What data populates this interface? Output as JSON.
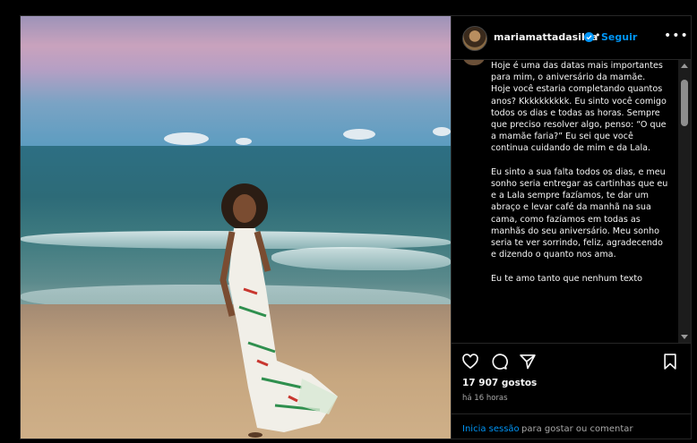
{
  "colors": {
    "background": "#000000",
    "text": "#f5f5f5",
    "secondary_text": "#a8a8a8",
    "link": "#0095f6",
    "border": "#262626"
  },
  "photo": {
    "description_icon": "beach-photo"
  },
  "header": {
    "username": "mariamattadasilva",
    "verified_icon": "verified-badge-icon",
    "separator": "•",
    "follow_label": "Seguir",
    "more_icon": "more-horizontal-icon",
    "more_label": "•••"
  },
  "caption": {
    "text": "Hoje é uma das datas mais importantes para mim, o aniversário da mamãe.\nHoje você estaria completando quantos anos? Kkkkkkkkkk. Eu sinto você comigo todos os dias e todas as horas. Sempre que preciso resolver algo, penso: “O que a mamãe faria?” Eu sei que você continua cuidando de mim e da Lala.\n\nEu sinto a sua falta todos os dias, e meu sonho seria entregar as cartinhas que eu e a Lala sempre fazíamos, te dar um abraço e levar café da manhã na sua cama, como fazíamos em todas as manhãs do seu aniversário. Meu sonho seria te ver sorrindo, feliz, agradecendo e dizendo o quanto nos ama.\n\nEu te amo tanto que nenhum texto"
  },
  "actions": {
    "like_icon": "heart-icon",
    "comment_icon": "comment-icon",
    "share_icon": "paper-plane-icon",
    "save_icon": "bookmark-icon",
    "likes_text": "17 907 gostos",
    "time_text": "há 16 horas"
  },
  "login": {
    "link_text": "Inicia sessão",
    "rest_text": "para gostar ou comentar"
  }
}
